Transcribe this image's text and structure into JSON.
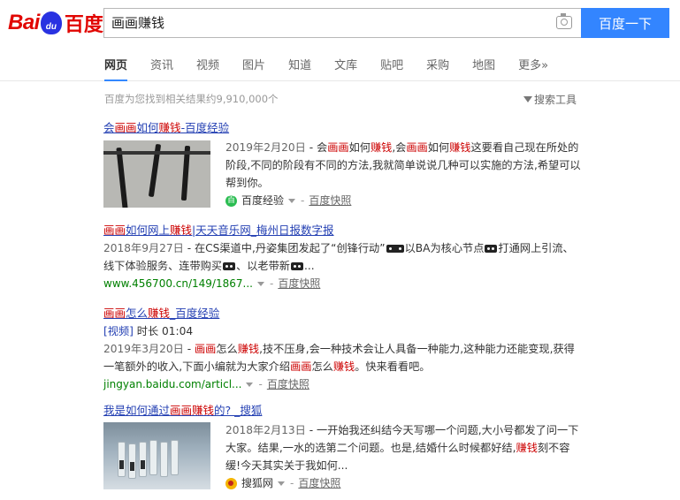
{
  "logo": {
    "left": "Bai",
    "paw": "du",
    "right": "百度"
  },
  "search": {
    "query": "画画赚钱",
    "button": "百度一下"
  },
  "tabs": [
    "网页",
    "资讯",
    "视频",
    "图片",
    "知道",
    "文库",
    "贴吧",
    "采购",
    "地图",
    "更多»"
  ],
  "results_info": "百度为您找到相关结果约9,910,000个",
  "search_tools": "搜索工具",
  "results": [
    {
      "title_parts": [
        "会",
        "画画",
        "如何",
        "赚钱",
        "-百度经验"
      ],
      "date": "2019年2月20日",
      "abstract_parts": [
        " - 会",
        "画画",
        "如何",
        "赚钱",
        ",会",
        "画画",
        "如何",
        "赚钱",
        "这要看自己现在所处的阶段,不同的阶段有不同的方法,我就简单说说几种可以实施的方法,希望可以帮到你。"
      ],
      "source": "百度经验",
      "source_icon": "百",
      "snapshot": "百度快照"
    },
    {
      "title_parts": [
        "画画",
        "如何网上",
        "赚钱",
        "|天天音乐网_梅州日报数字报"
      ],
      "date": "2018年9月27日",
      "abstract_a": " - 在CS渠道中,丹姿集团发起了“创锋行动”",
      "abstract_b": "以BA为核心节点",
      "abstract_c": "打通网上引流、线下体验服务、连带购买",
      "abstract_d": "、以老带新",
      "abstract_e": "...",
      "url": "www.456700.cn/149/1867...",
      "snapshot": "百度快照"
    },
    {
      "title_parts": [
        "画画",
        "怎么",
        "赚钱",
        "_百度经验"
      ],
      "video_tag": "[视频]",
      "duration": "时长 01:04",
      "date": "2019年3月20日",
      "abstract_parts": [
        " - ",
        "画画",
        "怎么",
        "赚钱",
        ",技不压身,会一种技术会让人具备一种能力,这种能力还能变现,获得一笔额外的收入,下面小编就为大家介绍",
        "画画",
        "怎么",
        "赚钱",
        "。快来看看吧。"
      ],
      "url": "jingyan.baidu.com/articl...",
      "snapshot": "百度快照"
    },
    {
      "title_parts": [
        "我是如何通过",
        "画画",
        "赚钱",
        "的? _搜狐"
      ],
      "date": "2018年2月13日",
      "abstract_a": " - 一开始我还纠结今天写哪一个问题,大小号都发了问一下大家。结果,一水的选第二个问题。也是,结婚什么时候都好结,",
      "abstract_hl": "赚",
      "abstract_hl2": "钱",
      "abstract_b": "刻不容缓!今天其实关于我如何...",
      "source": "搜狐网",
      "snapshot": "百度快照"
    }
  ]
}
